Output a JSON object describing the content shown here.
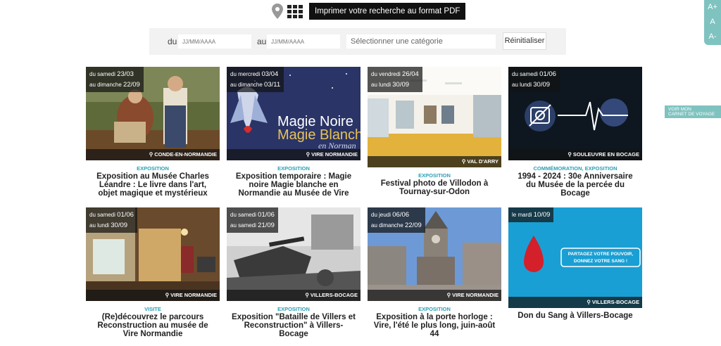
{
  "toolbar": {
    "map_icon": "map-pin-icon",
    "grid_icon": "grid-view-icon",
    "print_label": "Imprimer votre recherche au format PDF"
  },
  "filters": {
    "from_label": "du",
    "from_placeholder": "JJ/MM/AAAA",
    "to_label": "au",
    "to_placeholder": "JJ/MM/AAAA",
    "category_placeholder": "Sélectionner une catégorie",
    "reset_label": "Réinitialiser"
  },
  "font_controls": {
    "increase": "A+",
    "normal": "A",
    "decrease": "A-"
  },
  "carnet": {
    "line1": "VOIR MON",
    "line2": "CARNET DE VOYAGE"
  },
  "colors": {
    "accent": "#2aa0b5",
    "panel": "#7fc3c0"
  },
  "cards": [
    {
      "date_prefix1": "du samedi",
      "date1": "23/03",
      "date_prefix2": "au dimanche",
      "date2": "22/09",
      "location": "CONDE-EN-NORMANDIE",
      "category": "EXPOSITION",
      "title": "Exposition au Musée Charles Léandre : Le livre dans l'art, objet magique et mystérieux"
    },
    {
      "date_prefix1": "du mercredi",
      "date1": "03/04",
      "date_prefix2": "au dimanche",
      "date2": "03/11",
      "location": "VIRE NORMANDIE",
      "category": "EXPOSITION",
      "title": "Exposition temporaire : Magie noire Magie blanche en Normandie au Musée de Vire",
      "img_text1": "Magie Noire",
      "img_text2": "Magie Blanche",
      "img_text3": "en Norman"
    },
    {
      "date_prefix1": "du vendredi",
      "date1": "26/04",
      "date_prefix2": "au lundi",
      "date2": "30/09",
      "location": "VAL D'ARRY",
      "category": "EXPOSITION",
      "title": "Festival photo de Villodon à Tournay-sur-Odon"
    },
    {
      "date_prefix1": "du samedi",
      "date1": "01/06",
      "date_prefix2": "au lundi",
      "date2": "30/09",
      "location": "SOULEUVRE EN BOCAGE",
      "category": "COMMÉMORATION, EXPOSITION",
      "title": "1994 - 2024 : 30e Anniversaire du Musée de la percée du Bocage"
    },
    {
      "date_prefix1": "du samedi",
      "date1": "01/06",
      "date_prefix2": "au lundi",
      "date2": "30/09",
      "location": "VIRE NORMANDIE",
      "category": "VISITE",
      "title": "(Re)découvrez le parcours Reconstruction au musée de Vire Normandie"
    },
    {
      "date_prefix1": "du samedi",
      "date1": "01/06",
      "date_prefix2": "au samedi",
      "date2": "21/09",
      "location": "VILLERS-BOCAGE",
      "category": "EXPOSITION",
      "title": "Exposition \"Bataille de Villers et Reconstruction\" à Villers-Bocage"
    },
    {
      "date_prefix1": "du jeudi",
      "date1": "06/06",
      "date_prefix2": "au dimanche",
      "date2": "22/09",
      "location": "VIRE NORMANDIE",
      "category": "EXPOSITION",
      "title": "Exposition à la porte horloge : Vire, l'été le plus long, juin-août 44"
    },
    {
      "date_prefix1": "le mardi",
      "date1": "10/09",
      "location": "VILLERS-BOCAGE",
      "category": "",
      "title": "Don du Sang à Villers-Bocage",
      "img_text1": "PARTAGEZ VOTRE POUVOIR,",
      "img_text2": "DONNEZ VOTRE SANG !"
    }
  ]
}
